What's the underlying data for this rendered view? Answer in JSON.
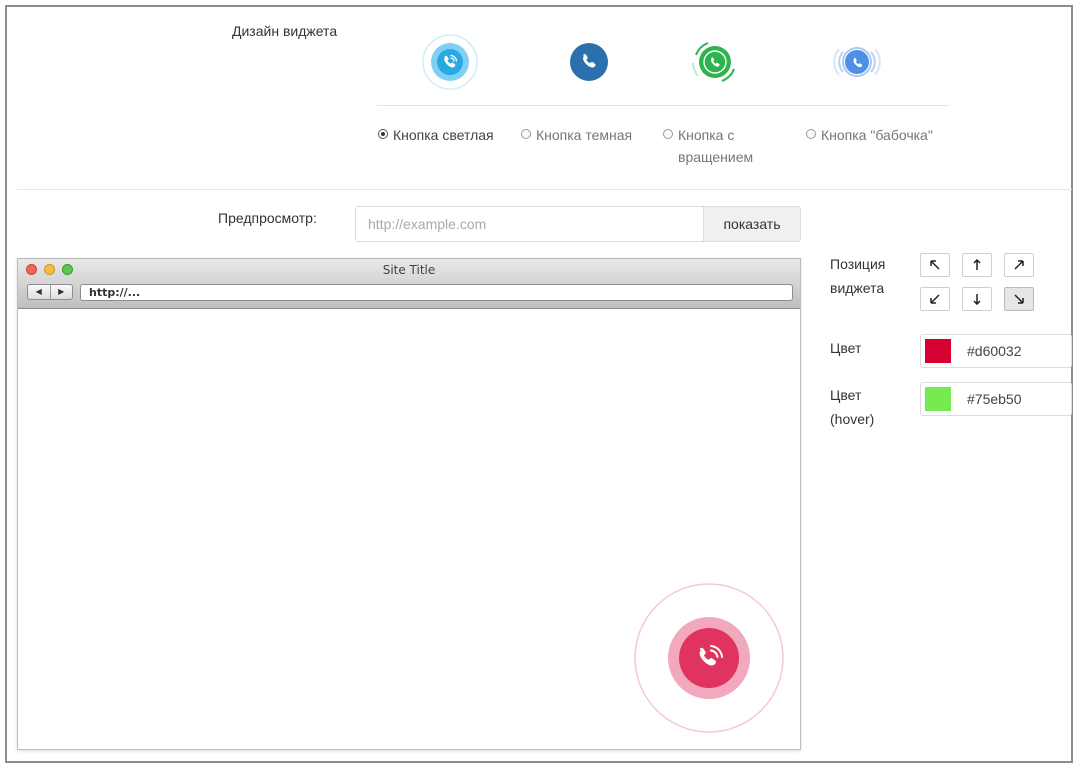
{
  "widget_design": {
    "label": "Дизайн виджета",
    "options": [
      {
        "label": "Кнопка светлая",
        "selected": true,
        "icon": "light-call-icon"
      },
      {
        "label": "Кнопка темная",
        "selected": false,
        "icon": "dark-call-icon"
      },
      {
        "label": "Кнопка с вращением",
        "line1": "Кнопка с",
        "line2": "вращением",
        "selected": false,
        "icon": "rotating-call-icon"
      },
      {
        "label": "Кнопка \"бабочка\"",
        "selected": false,
        "icon": "butterfly-call-icon"
      }
    ]
  },
  "preview": {
    "label": "Предпросмотр:",
    "url_placeholder": "http://example.com",
    "url_value": "",
    "show_button": "показать"
  },
  "browser": {
    "title": "Site Title",
    "address": "http://..."
  },
  "position": {
    "label_line1": "Позиция",
    "label_line2": "виджета",
    "buttons": [
      {
        "name": "top-left",
        "active": false
      },
      {
        "name": "top-center",
        "active": false
      },
      {
        "name": "top-right",
        "active": false
      },
      {
        "name": "bottom-left",
        "active": false
      },
      {
        "name": "bottom-center",
        "active": false
      },
      {
        "name": "bottom-right",
        "active": true
      }
    ]
  },
  "color": {
    "label": "Цвет",
    "value": "#d60032"
  },
  "hover_color": {
    "label_line1": "Цвет",
    "label_line2": "(hover)",
    "value": "#75eb50"
  },
  "colors": {
    "widget_preview": "#e0335f",
    "light_icon": "#29a9e1",
    "dark_icon": "#2a6fae",
    "rotating_icon": "#2eb34d",
    "butterfly_icon": "#4d90e6"
  }
}
